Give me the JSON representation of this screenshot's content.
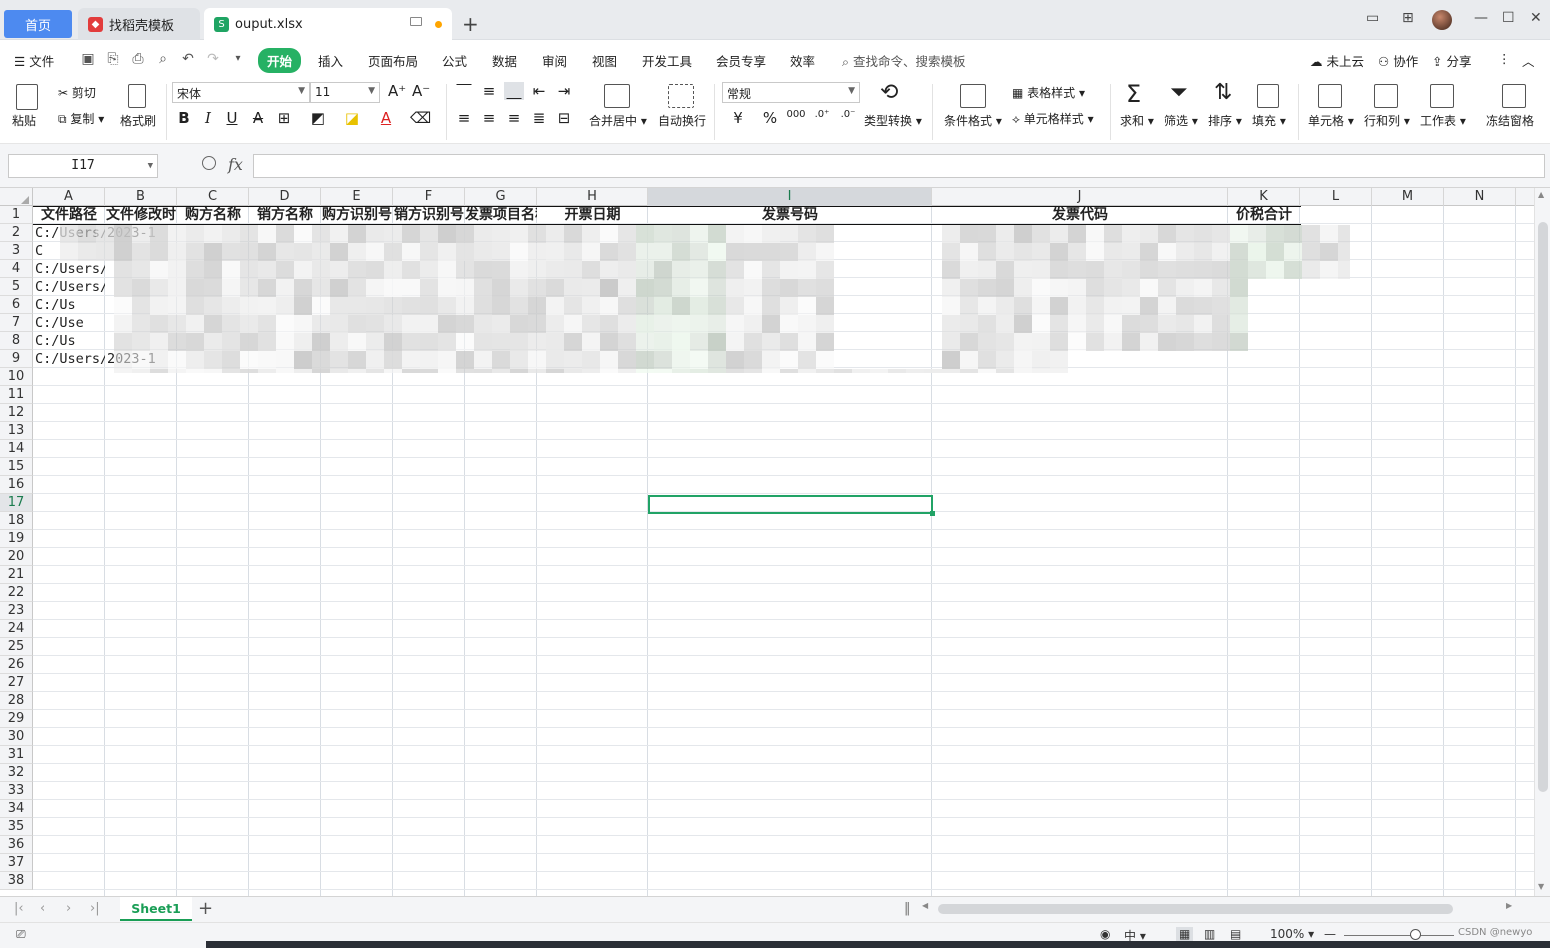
{
  "titlebar": {
    "tabs": [
      {
        "label": "首页"
      },
      {
        "label": "找稻壳模板"
      },
      {
        "label": "ouput.xlsx"
      }
    ]
  },
  "menubar": {
    "file": "文件",
    "items": [
      "开始",
      "插入",
      "页面布局",
      "公式",
      "数据",
      "审阅",
      "视图",
      "开发工具",
      "会员专享",
      "效率"
    ],
    "active": "开始",
    "search": "查找命令、搜索模板",
    "right": [
      "未上云",
      "协作",
      "分享"
    ]
  },
  "ribbon": {
    "paste": "粘贴",
    "cut": "剪切",
    "copy": "复制",
    "format_painter": "格式刷",
    "font_name": "宋体",
    "font_size": "11",
    "merge": "合并居中",
    "wrap": "自动换行",
    "number_format": "常规",
    "currency": "¥",
    "percent": "%",
    "thousands": "000",
    "type_convert": "类型转换",
    "cond_format": "条件格式",
    "table_style": "表格样式",
    "cell_style": "单元格样式",
    "sum": "求和",
    "filter": "筛选",
    "sort": "排序",
    "fill": "填充",
    "cell": "单元格",
    "rowcol": "行和列",
    "worksheet": "工作表",
    "freeze": "冻结窗格"
  },
  "formulabar": {
    "namebox": "I17",
    "fx": "fx",
    "value": ""
  },
  "grid": {
    "columns": [
      "A",
      "B",
      "C",
      "D",
      "E",
      "F",
      "G",
      "H",
      "I",
      "J",
      "K",
      "L",
      "M",
      "N"
    ],
    "rows": [
      "1",
      "2",
      "3",
      "4",
      "5",
      "6",
      "7",
      "8",
      "9",
      "10",
      "11",
      "12",
      "13",
      "14",
      "15",
      "16",
      "17",
      "18",
      "19",
      "20",
      "21",
      "22",
      "23",
      "24",
      "25",
      "26",
      "27",
      "28",
      "29",
      "30",
      "31",
      "32",
      "33",
      "34",
      "35",
      "36",
      "37",
      "38"
    ],
    "headers": [
      "文件路径",
      "文件修改时",
      "购方名称",
      "销方名称",
      "购方识别号",
      "销方识别号",
      "发票项目名称",
      "开票日期",
      "发票号码",
      "发票代码",
      "价税合计"
    ],
    "col_a_values": [
      "C:/Users/",
      "C",
      "C:/Users/",
      "C:/Users/",
      "C:/Us",
      "C:/Use",
      "C:/Us",
      "C:/Users/"
    ],
    "col_b_values": [
      "2023-1",
      "",
      "",
      "",
      "",
      "",
      "",
      "2023-1"
    ],
    "selected_cell": "I17"
  },
  "sheets": {
    "tabs": [
      "Sheet1"
    ]
  },
  "statusbar": {
    "zoom": "100%",
    "watermark": "CSDN @newyo"
  }
}
